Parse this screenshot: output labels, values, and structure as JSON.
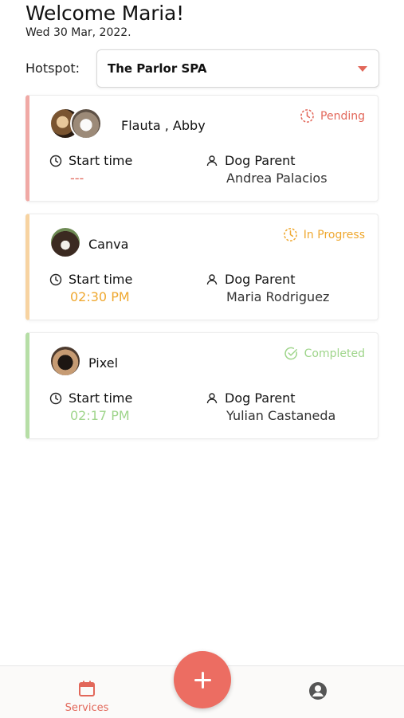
{
  "header": {
    "welcome": "Welcome Maria!",
    "date": "Wed 30 Mar, 2022."
  },
  "hotspot": {
    "label": "Hotspot:",
    "value": "The Parlor SPA"
  },
  "cards": [
    {
      "pets": "Flauta , Abby",
      "status": "Pending",
      "start_label": "Start time",
      "start_value": "---",
      "parent_label": "Dog Parent",
      "parent_value": "Andrea  Palacios"
    },
    {
      "pets": "Canva",
      "status": "In Progress",
      "start_label": "Start time",
      "start_value": "02:30 PM",
      "parent_label": "Dog Parent",
      "parent_value": "Maria Rodriguez"
    },
    {
      "pets": "Pixel",
      "status": "Completed",
      "start_label": "Start time",
      "start_value": "02:17 PM",
      "parent_label": "Dog Parent",
      "parent_value": "Yulian Castaneda"
    }
  ],
  "nav": {
    "services": "Services"
  },
  "colors": {
    "accent": "#e2675a",
    "pending": "#e2675a",
    "in_progress": "#efa830",
    "completed": "#9fd58b"
  },
  "icons": [
    "clock-icon",
    "person-icon",
    "pending-icon",
    "in-progress-icon",
    "completed-check-icon",
    "calendar-icon",
    "profile-icon",
    "plus-icon",
    "caret-down-icon"
  ]
}
